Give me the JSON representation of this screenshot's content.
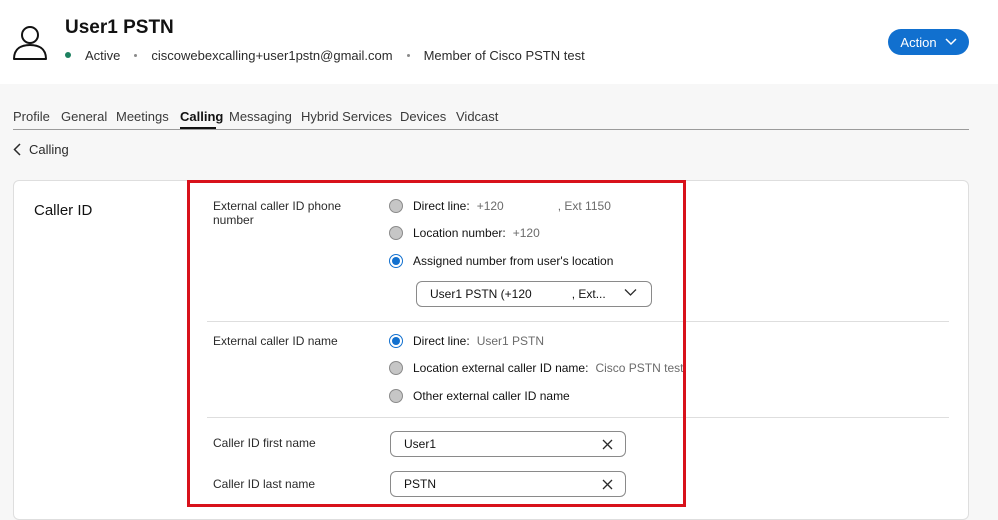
{
  "header": {
    "user_name": "User1 PSTN",
    "status": "Active",
    "email": "ciscowebexcalling+user1pstn@gmail.com",
    "membership": "Member of Cisco PSTN test",
    "action_label": "Action"
  },
  "tabs": [
    "Profile",
    "General",
    "Meetings",
    "Calling",
    "Messaging",
    "Hybrid Services",
    "Devices",
    "Vidcast"
  ],
  "active_tab": "Calling",
  "back": {
    "label": "Calling"
  },
  "card": {
    "title": "Caller ID",
    "external_phone": {
      "label_line1": "External caller ID phone",
      "label_line2": "number",
      "options": [
        {
          "label": "Direct line:",
          "value": "+120",
          "extra": ", Ext 1150",
          "selected": false
        },
        {
          "label": "Location number:",
          "value": "+120",
          "selected": false
        },
        {
          "label": "Assigned number from user's location",
          "selected": true
        }
      ],
      "select_value": "User1 PSTN (+120",
      "select_extra": ", Ext..."
    },
    "external_name": {
      "label": "External caller ID name",
      "options": [
        {
          "label": "Direct line:",
          "value": "User1 PSTN",
          "selected": true
        },
        {
          "label": "Location external caller ID name:",
          "value": "Cisco PSTN test",
          "selected": false
        },
        {
          "label": "Other external caller ID name",
          "selected": false
        }
      ]
    },
    "first_name": {
      "label": "Caller ID first name",
      "value": "User1"
    },
    "last_name": {
      "label": "Caller ID last name",
      "value": "PSTN"
    }
  },
  "colors": {
    "accent": "#1170cf",
    "highlight": "#d8111b",
    "status_active": "#1d8160"
  }
}
